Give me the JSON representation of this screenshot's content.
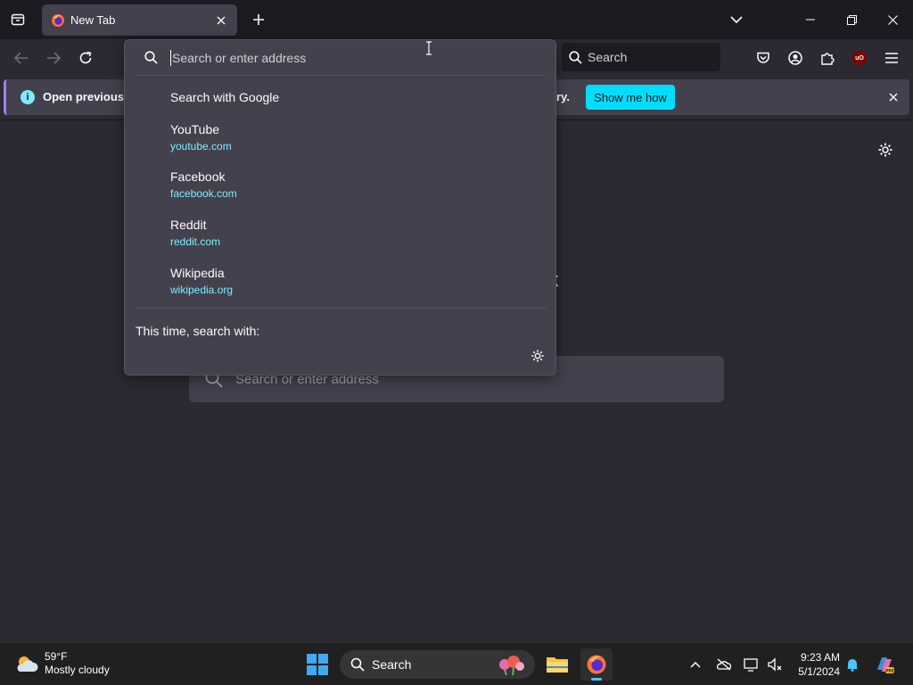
{
  "tab": {
    "title": "New Tab"
  },
  "navbar": {
    "search_placeholder": "Search"
  },
  "notification": {
    "text": "Open previous tab",
    "text_tail": "ry.",
    "cta": "Show me how"
  },
  "urlbar": {
    "placeholder": "Search or enter address",
    "search_with": "Search with Google",
    "suggestions": [
      {
        "title": "YouTube",
        "url": "youtube.com"
      },
      {
        "title": "Facebook",
        "url": "facebook.com"
      },
      {
        "title": "Reddit",
        "url": "reddit.com"
      },
      {
        "title": "Wikipedia",
        "url": "wikipedia.org"
      }
    ],
    "oneoff_label": "This time, search with:"
  },
  "newtab": {
    "search_placeholder": "Search or enter address"
  },
  "taskbar": {
    "weather_temp": "59°F",
    "weather_cond": "Mostly cloudy",
    "search_label": "Search",
    "time": "9:23 AM",
    "date": "5/1/2024"
  },
  "colors": {
    "accent": "#00ddff",
    "link": "#80ebff",
    "background": "#2b2a33",
    "tabstrip": "#1c1b22"
  }
}
